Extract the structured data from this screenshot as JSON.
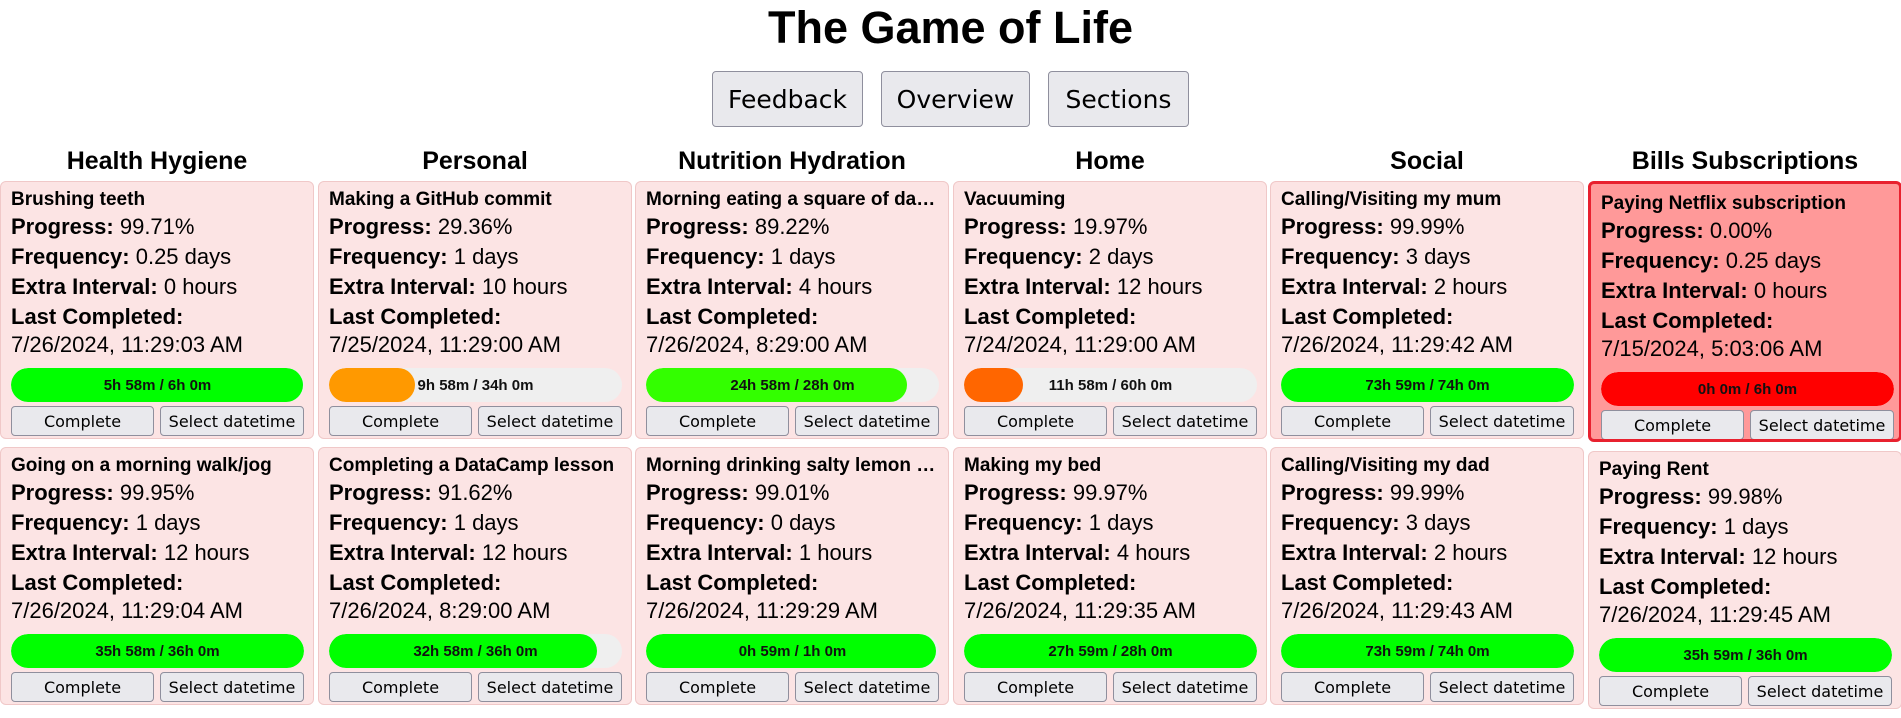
{
  "app_title": "The Game of Life",
  "nav": {
    "feedback_label": "Feedback",
    "overview_label": "Overview",
    "sections_label": "Sections"
  },
  "labels": {
    "progress": "Progress:",
    "frequency": "Frequency:",
    "extra_interval": "Extra Interval:",
    "last_completed": "Last Completed:",
    "complete_button": "Complete",
    "select_datetime_button": "Select datetime"
  },
  "colors": {
    "card_bg": "#fce4e4",
    "alert_card_bg": "#ff9999",
    "alert_border": "#e8212f",
    "bar_green": "#00ff00",
    "bar_orange": "#ff9900",
    "bar_dark_orange": "#ff6600",
    "bar_red": "#ff0000"
  },
  "sections": [
    {
      "title": "Health Hygiene",
      "tasks": [
        {
          "name": "Brushing teeth",
          "progress": "99.71%",
          "frequency": "0.25 days",
          "extra_interval": "0 hours",
          "last_completed": "7/26/2024, 11:29:03 AM",
          "bar_text": "5h 58m / 6h 0m",
          "bar_fraction": 0.9971,
          "bar_color": "#00ff00",
          "alert": false
        },
        {
          "name": "Going on a morning walk/jog",
          "progress": "99.95%",
          "frequency": "1 days",
          "extra_interval": "12 hours",
          "last_completed": "7/26/2024, 11:29:04 AM",
          "bar_text": "35h 58m / 36h 0m",
          "bar_fraction": 0.9995,
          "bar_color": "#00ff00",
          "alert": false
        }
      ]
    },
    {
      "title": "Personal",
      "tasks": [
        {
          "name": "Making a GitHub commit",
          "progress": "29.36%",
          "frequency": "1 days",
          "extra_interval": "10 hours",
          "last_completed": "7/25/2024, 11:29:00 AM",
          "bar_text": "9h 58m / 34h 0m",
          "bar_fraction": 0.2936,
          "bar_color": "#ff9900",
          "alert": false
        },
        {
          "name": "Completing a DataCamp lesson",
          "progress": "91.62%",
          "frequency": "1 days",
          "extra_interval": "12 hours",
          "last_completed": "7/26/2024, 8:29:00 AM",
          "bar_text": "32h 58m / 36h 0m",
          "bar_fraction": 0.9162,
          "bar_color": "#00ff00",
          "alert": false
        }
      ]
    },
    {
      "title": "Nutrition Hydration",
      "tasks": [
        {
          "name": "Morning eating a square of dark chocolate",
          "progress": "89.22%",
          "frequency": "1 days",
          "extra_interval": "4 hours",
          "last_completed": "7/26/2024, 8:29:00 AM",
          "bar_text": "24h 58m / 28h 0m",
          "bar_fraction": 0.8922,
          "bar_color": "#33ff00",
          "alert": false
        },
        {
          "name": "Morning drinking salty lemon water",
          "progress": "99.01%",
          "frequency": "0 days",
          "extra_interval": "1 hours",
          "last_completed": "7/26/2024, 11:29:29 AM",
          "bar_text": "0h 59m / 1h 0m",
          "bar_fraction": 0.9901,
          "bar_color": "#00ff00",
          "alert": false
        }
      ]
    },
    {
      "title": "Home",
      "tasks": [
        {
          "name": "Vacuuming",
          "progress": "19.97%",
          "frequency": "2 days",
          "extra_interval": "12 hours",
          "last_completed": "7/24/2024, 11:29:00 AM",
          "bar_text": "11h 58m / 60h 0m",
          "bar_fraction": 0.1997,
          "bar_color": "#ff6600",
          "alert": false
        },
        {
          "name": "Making my bed",
          "progress": "99.97%",
          "frequency": "1 days",
          "extra_interval": "4 hours",
          "last_completed": "7/26/2024, 11:29:35 AM",
          "bar_text": "27h 59m / 28h 0m",
          "bar_fraction": 0.9997,
          "bar_color": "#00ff00",
          "alert": false
        }
      ]
    },
    {
      "title": "Social",
      "tasks": [
        {
          "name": "Calling/Visiting my mum",
          "progress": "99.99%",
          "frequency": "3 days",
          "extra_interval": "2 hours",
          "last_completed": "7/26/2024, 11:29:42 AM",
          "bar_text": "73h 59m / 74h 0m",
          "bar_fraction": 0.9999,
          "bar_color": "#00ff00",
          "alert": false
        },
        {
          "name": "Calling/Visiting my dad",
          "progress": "99.99%",
          "frequency": "3 days",
          "extra_interval": "2 hours",
          "last_completed": "7/26/2024, 11:29:43 AM",
          "bar_text": "73h 59m / 74h 0m",
          "bar_fraction": 0.9999,
          "bar_color": "#00ff00",
          "alert": false
        }
      ]
    },
    {
      "title": "Bills Subscriptions",
      "tasks": [
        {
          "name": "Paying Netflix subscription",
          "progress": "0.00%",
          "frequency": "0.25 days",
          "extra_interval": "0 hours",
          "last_completed": "7/15/2024, 5:03:06 AM",
          "bar_text": "0h 0m / 6h 0m",
          "bar_fraction": 1.0,
          "bar_color": "#ff0000",
          "alert": true
        },
        {
          "name": "Paying Rent",
          "progress": "99.98%",
          "frequency": "1 days",
          "extra_interval": "12 hours",
          "last_completed": "7/26/2024, 11:29:45 AM",
          "bar_text": "35h 59m / 36h 0m",
          "bar_fraction": 0.9998,
          "bar_color": "#00ff00",
          "alert": false
        }
      ]
    }
  ]
}
